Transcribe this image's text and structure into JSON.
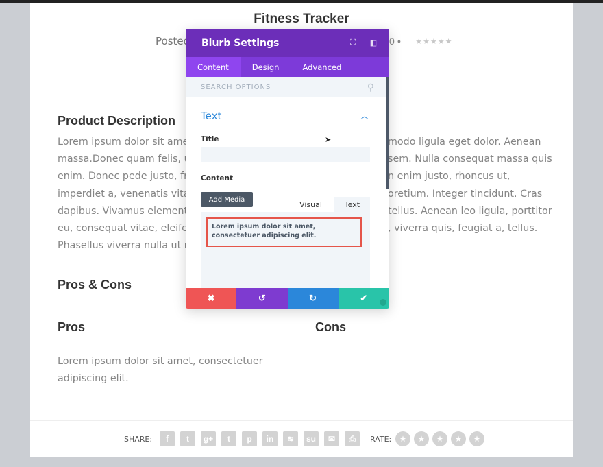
{
  "post": {
    "title": "Fitness Tracker",
    "meta_prefix": "Posted",
    "comment_count_fragment": "0",
    "comment_icon": "comment-icon",
    "rating_stars_icon": "★★★★★"
  },
  "main": {
    "product_description_heading": "Product Description",
    "product_description_left_lines": [
      "Lorem ipsum dolor sit amet",
      "massa.Donec quam felis, ul",
      "enim. Donec pede justo, fri",
      "imperdiet a, venenatis vitae",
      "dapibus. Vivamus elementu",
      "eu, consequat vitae, eleifen",
      "Phasellus viverra nulla ut m"
    ],
    "product_description_right_lines": [
      "modo ligula eget dolor. Aenean",
      "sem. Nulla consequat massa quis",
      "n enim justo, rhoncus ut,",
      "oretium. Integer tincidunt. Cras",
      "tellus. Aenean leo ligula, porttitor",
      ", viverra quis, feugiat a, tellus."
    ],
    "pros_cons_heading": "Pros & Cons",
    "pros_heading": "Pros",
    "cons_heading": "Cons",
    "pros_text_lines": [
      "Lorem ipsum dolor sit amet, consectetuer",
      "adipiscing elit."
    ]
  },
  "footer": {
    "share_label": "SHARE:",
    "share_icons": [
      {
        "name": "facebook-icon",
        "glyph": "f"
      },
      {
        "name": "twitter-icon",
        "glyph": "t"
      },
      {
        "name": "google-plus-icon",
        "glyph": "g+"
      },
      {
        "name": "tumblr-icon",
        "glyph": "t"
      },
      {
        "name": "pinterest-icon",
        "glyph": "p"
      },
      {
        "name": "linkedin-icon",
        "glyph": "in"
      },
      {
        "name": "buffer-icon",
        "glyph": "≋"
      },
      {
        "name": "stumbleupon-icon",
        "glyph": "su"
      },
      {
        "name": "email-icon",
        "glyph": "✉"
      },
      {
        "name": "print-icon",
        "glyph": "⎙"
      }
    ],
    "rate_label": "RATE:",
    "rate_star_glyph": "★",
    "rate_star_count": 5
  },
  "modal": {
    "title": "Blurb Settings",
    "header_icons": [
      "fullscreen-icon",
      "sidebar-toggle-icon"
    ],
    "tabs": [
      {
        "label": "Content",
        "active": true
      },
      {
        "label": "Design",
        "active": false
      },
      {
        "label": "Advanced",
        "active": false
      }
    ],
    "search_placeholder": "SEARCH OPTIONS",
    "section_title": "Text",
    "title_label": "Title",
    "title_value": "",
    "content_label": "Content",
    "add_media_label": "Add Media",
    "editor_tabs": {
      "visual": "Visual",
      "text": "Text"
    },
    "editor_content": "Lorem ipsum dolor sit amet, consectetuer adipiscing elit.",
    "footer_buttons": {
      "cancel": "✖",
      "undo": "↺",
      "redo": "↻",
      "save": "✔"
    },
    "colors": {
      "header": "#6c2eb9",
      "tabs": "#7d3ad9",
      "active_tab": "#8f45ef",
      "accent": "#2b87da",
      "cancel": "#ef5555",
      "undo": "#7e3bd0",
      "redo": "#2b87da",
      "save": "#29c4a9",
      "highlight_border": "#e5554a"
    }
  }
}
